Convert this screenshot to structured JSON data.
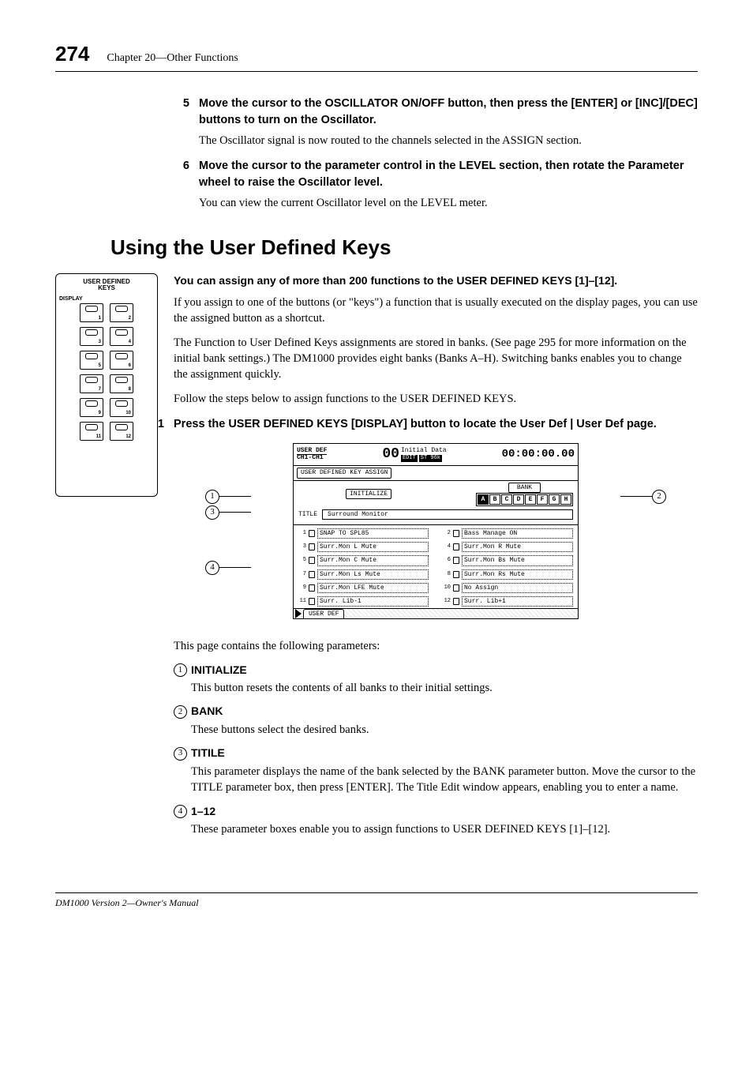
{
  "header": {
    "page_number": "274",
    "chapter": "Chapter 20—Other Functions"
  },
  "steps_top": [
    {
      "num": "5",
      "head": "Move the cursor to the OSCILLATOR ON/OFF button, then press the [ENTER] or [INC]/[DEC] buttons to turn on the Oscillator.",
      "body": "The Oscillator signal is now routed to the channels selected in the ASSIGN section."
    },
    {
      "num": "6",
      "head": "Move the cursor to the parameter control in the LEVEL section, then rotate the Parameter wheel to raise the Oscillator level.",
      "body": "You can view the current Oscillator level on the LEVEL meter."
    }
  ],
  "section_title": "Using the User Defined Keys",
  "panel": {
    "title_line1": "USER DEFINED",
    "title_line2": "KEYS",
    "display_label": "DISPLAY",
    "keys": [
      "1",
      "2",
      "3",
      "4",
      "5",
      "6",
      "7",
      "8",
      "9",
      "10",
      "11",
      "12"
    ]
  },
  "intro": {
    "bold": "You can assign any of more than 200 functions to the USER DEFINED KEYS [1]–[12].",
    "p1": "If you assign to one of the buttons (or \"keys\") a function that is usually executed on the display pages, you can use the assigned button as a shortcut.",
    "p2": "The Function to User Defined Keys assignments are stored in banks. (See page 295 for more information on the initial bank settings.) The DM1000 provides eight banks (Banks A–H). Switching banks enables you to change the assignment quickly.",
    "p3": "Follow the steps below to assign functions to the USER DEFINED KEYS."
  },
  "step1": {
    "num": "1",
    "head": "Press the USER DEFINED KEYS [DISPLAY] button to locate the User Def | User Def page."
  },
  "screen": {
    "top_left1": "USER DEF",
    "top_left2": "CH1-CH1",
    "big": "00",
    "edit": "EDIT",
    "mid1": "Initial Data",
    "mid2": "ST 96k",
    "time": "00:00:00.00",
    "sub": "USER DEFINED KEY ASSIGN",
    "init_btn": "INITIALIZE",
    "bank_label": "BANK",
    "banks": [
      "A",
      "B",
      "C",
      "D",
      "E",
      "F",
      "G",
      "H"
    ],
    "title_label": "TITLE",
    "title_value": "Surround Monitor",
    "assignments": [
      {
        "n": "1",
        "v": "SNAP TO SPL85"
      },
      {
        "n": "2",
        "v": "Bass Manage ON"
      },
      {
        "n": "3",
        "v": "Surr.Mon L  Mute"
      },
      {
        "n": "4",
        "v": "Surr.Mon R  Mute"
      },
      {
        "n": "5",
        "v": "Surr.Mon C  Mute"
      },
      {
        "n": "6",
        "v": "Surr.Mon Bs Mute"
      },
      {
        "n": "7",
        "v": "Surr.Mon Ls Mute"
      },
      {
        "n": "8",
        "v": "Surr.Mon Rs Mute"
      },
      {
        "n": "9",
        "v": "Surr.Mon LFE Mute"
      },
      {
        "n": "10",
        "v": "No Assign"
      },
      {
        "n": "11",
        "v": "Surr. Lib-1"
      },
      {
        "n": "12",
        "v": "Surr. Lib+1"
      }
    ],
    "tab": "USER DEF"
  },
  "params_intro": "This page contains the following parameters:",
  "params": [
    {
      "n": "1",
      "label": "INITIALIZE",
      "body": "This button resets the contents of all banks to their initial settings."
    },
    {
      "n": "2",
      "label": "BANK",
      "body": "These buttons select the desired banks."
    },
    {
      "n": "3",
      "label": "TITILE",
      "body": "This parameter displays the name of the bank selected by the BANK parameter button. Move the cursor to the TITLE parameter box, then press [ENTER]. The Title Edit window appears, enabling you to enter a name."
    },
    {
      "n": "4",
      "label": "1–12",
      "body": "These parameter boxes enable you to assign functions to USER DEFINED KEYS [1]–[12]."
    }
  ],
  "footer": "DM1000 Version 2—Owner's Manual"
}
